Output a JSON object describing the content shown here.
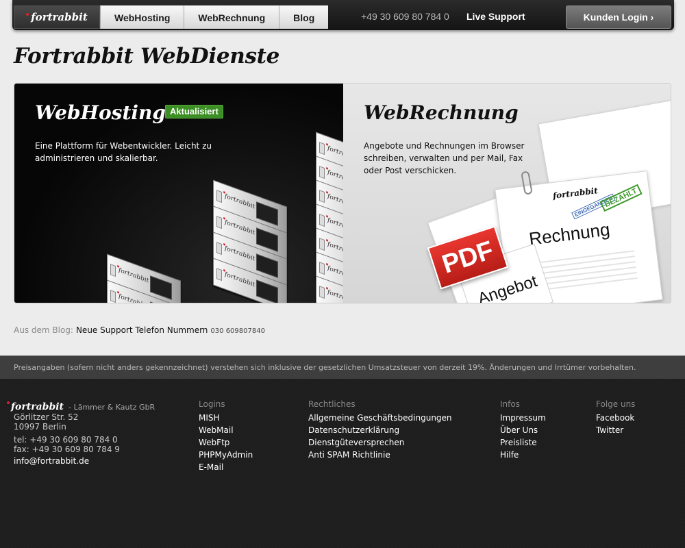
{
  "nav": {
    "logo": "fortrabbit",
    "tabs": [
      "WebHosting",
      "WebRechnung",
      "Blog"
    ],
    "phone": "+49 30 609 80 784 0",
    "live_support": "Live Support",
    "login": "Kunden Login ›"
  },
  "page_title": "Fortrabbit WebDienste",
  "hosting": {
    "title": "WebHosting",
    "badge": "Aktualisiert",
    "description": "Eine Plattform für Webentwickler. Leicht zu administrieren und skalierbar.",
    "server_label": "fortrabbit"
  },
  "rechnung": {
    "title": "WebRechnung",
    "description": "Angebote und Rechnungen im Browser schreiben, verwalten und per Mail, Fax oder Post verschicken.",
    "doc_logo": "fortrabbit",
    "doc_word": "Rechnung",
    "stamp_bezahlt": "BEZAHLT",
    "stamp_eingegangen": "EINGEGANGEN",
    "pdf": "PDF",
    "angebot": "Angebot"
  },
  "blog": {
    "prefix": "Aus dem Blog:",
    "link": "Neue Support Telefon Nummern",
    "number": "030 609807840"
  },
  "price_note": "Preisangaben (sofern nicht anders gekennzeichnet) verstehen sich inklusive der gesetzlichen Umsatzsteuer von derzeit 19%. Änderungen und Irrtümer vorbehalten.",
  "footer": {
    "company": {
      "brand": "fortrabbit",
      "firm": "- Lämmer & Kautz GbR",
      "street": "Görlitzer Str. 52",
      "city": "10997 Berlin",
      "tel": "tel: +49 30 609 80 784 0",
      "fax": "fax: +49 30 609 80 784 9",
      "email": "info@fortrabbit.de"
    },
    "logins": {
      "head": "Logins",
      "items": [
        "MISH",
        "WebMail",
        "WebFtp",
        "PHPMyAdmin",
        "E-Mail"
      ]
    },
    "rechtliches": {
      "head": "Rechtliches",
      "items": [
        "Allgemeine Geschäftsbedingungen",
        "Datenschutzerklärung",
        "Dienstgüteversprechen",
        "Anti SPAM Richtlinie"
      ]
    },
    "infos": {
      "head": "Infos",
      "items": [
        "Impressum",
        "Über Uns",
        "Preisliste",
        "Hilfe"
      ]
    },
    "social": {
      "head": "Folge uns",
      "items": [
        "Facebook",
        "Twitter"
      ]
    }
  }
}
